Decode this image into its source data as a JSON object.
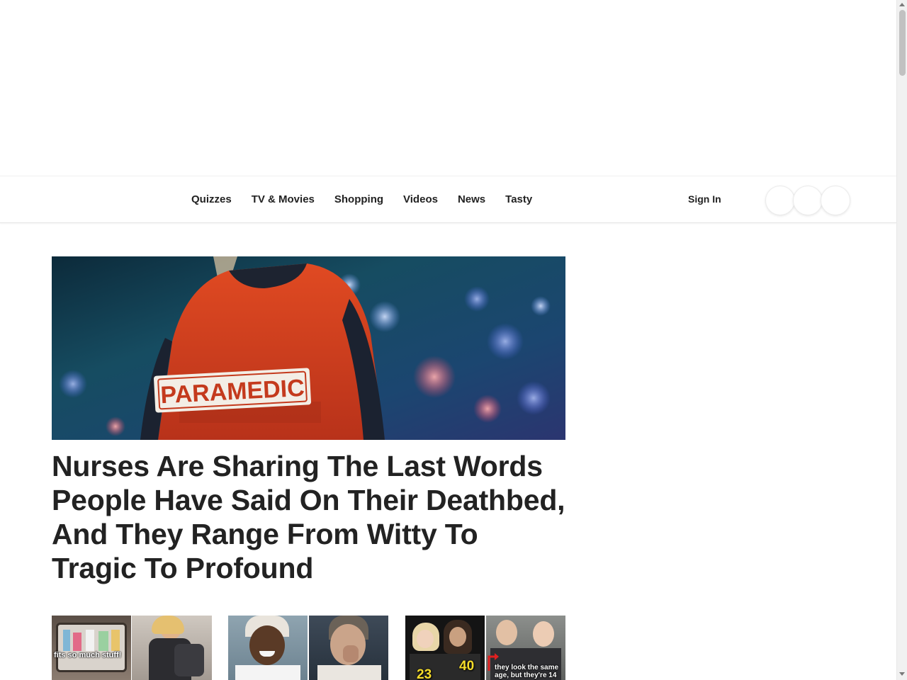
{
  "nav": {
    "items": [
      "Quizzes",
      "TV & Movies",
      "Shopping",
      "Videos",
      "News",
      "Tasty"
    ],
    "sign_in": "Sign In"
  },
  "hero": {
    "image_text": "PARAMEDIC",
    "title": "Nurses Are Sharing The Last Words People Have Said On Their Deathbed, And They Range From Witty To Tragic To Profound"
  },
  "thumbnails": {
    "t1_caption": "fits so much stuff!",
    "t3_num_left": "23",
    "t3_num_right": "40",
    "t3_caption": "they look the same age, but they're 14"
  },
  "colors": {
    "text": "#222222",
    "accent_yellow": "#f5dc2a",
    "paramedic_orange": "#d8431f"
  }
}
